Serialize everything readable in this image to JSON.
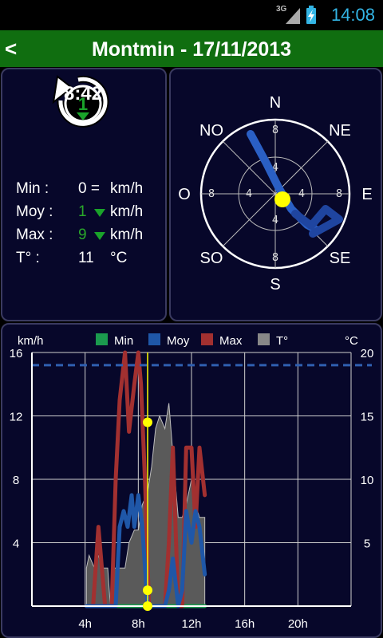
{
  "status": {
    "network": "3G",
    "time": "14:08"
  },
  "header": {
    "back_label": "<",
    "title": "Montmin - 17/11/2013"
  },
  "current": {
    "rank": "1",
    "time": "8:42",
    "rows": [
      {
        "label": "Min :",
        "value": "0 =",
        "unit": "km/h"
      },
      {
        "label": "Moy :",
        "value": "1",
        "unit": "km/h"
      },
      {
        "label": "Max :",
        "value": "9",
        "unit": "km/h"
      },
      {
        "label": "T° :",
        "value": "11",
        "unit": "°C"
      }
    ]
  },
  "compass": {
    "directions": [
      "N",
      "NE",
      "E",
      "SE",
      "S",
      "SO",
      "O",
      "NO"
    ],
    "ring_labels": [
      "8",
      "4",
      "4",
      "8"
    ]
  },
  "colors": {
    "min": "#1b9a4e",
    "moy": "#1f57a8",
    "max": "#a23030",
    "temp": "#888888",
    "accent": "#33b5e5",
    "header": "#106e10",
    "marker": "#ffff00"
  },
  "chart_data": {
    "type": "line",
    "ylabel": "km/h",
    "ylabel_right": "°C",
    "legend": [
      "Min",
      "Moy",
      "Max",
      "T°"
    ],
    "x_ticks": [
      "4h",
      "8h",
      "12h",
      "16h",
      "20h"
    ],
    "y_ticks": [
      "4",
      "8",
      "12",
      "16"
    ],
    "y_right_ticks": [
      "5",
      "10",
      "15",
      "20"
    ],
    "xlim": [
      0,
      24
    ],
    "ylim": [
      0,
      16
    ],
    "ylim_right": [
      0,
      20
    ],
    "reference_line": 15.2,
    "cursor_hour": 8.7,
    "series": [
      {
        "name": "Max",
        "x": [
          4.1,
          4.6,
          5.0,
          5.5,
          6.0,
          6.3,
          6.6,
          7.0,
          7.3,
          7.7,
          8.0,
          8.2,
          8.5,
          8.8,
          9.0,
          9.3,
          9.6,
          10.0,
          10.3,
          10.6,
          11.0,
          11.3,
          11.6,
          12.0,
          12.3,
          12.6,
          13.0
        ],
        "values": [
          0,
          0,
          5,
          0,
          0,
          8,
          13,
          16,
          11,
          14,
          16,
          14,
          8,
          0,
          0,
          0,
          0,
          0,
          4,
          10,
          0,
          0,
          10,
          10,
          5,
          10,
          7
        ]
      },
      {
        "name": "Moy",
        "x": [
          4.1,
          4.6,
          5.0,
          5.5,
          6.0,
          6.3,
          6.6,
          6.9,
          7.2,
          7.5,
          7.7,
          8.0,
          8.3,
          8.7,
          9.0,
          9.3,
          9.6,
          10.0,
          10.3,
          10.6,
          11.0,
          11.3,
          11.6,
          12.0,
          12.3,
          12.6,
          13.0
        ],
        "values": [
          0,
          0,
          0,
          0,
          0,
          0,
          5,
          6,
          5,
          7,
          5,
          7,
          5,
          0,
          0,
          0,
          0,
          0,
          1,
          3,
          0,
          1,
          6,
          4,
          6,
          5,
          2
        ]
      },
      {
        "name": "Min",
        "x": [
          5.8,
          13.0
        ],
        "values": [
          0,
          0
        ]
      },
      {
        "name": "T°",
        "x": [
          4.1,
          4.3,
          4.7,
          5.0,
          5.3,
          5.7,
          5.9,
          6.2,
          6.5,
          7.0,
          7.3,
          7.7,
          8.0,
          8.3,
          8.7,
          9.0,
          9.3,
          9.6,
          10.0,
          10.3,
          10.6,
          11.0,
          11.3,
          11.6,
          12.0,
          12.3,
          12.6,
          13.0
        ],
        "values": [
          3,
          4,
          3,
          4,
          3,
          3,
          0,
          3,
          3,
          3,
          5,
          6,
          6,
          8,
          9,
          11,
          14,
          15,
          14,
          16,
          12,
          7,
          7,
          8,
          10,
          8,
          7,
          7
        ]
      }
    ],
    "markers": [
      {
        "series": "Max",
        "value": 11.6
      },
      {
        "series": "Moy",
        "value": 1.0
      },
      {
        "series": "Min",
        "value": 0
      }
    ]
  }
}
